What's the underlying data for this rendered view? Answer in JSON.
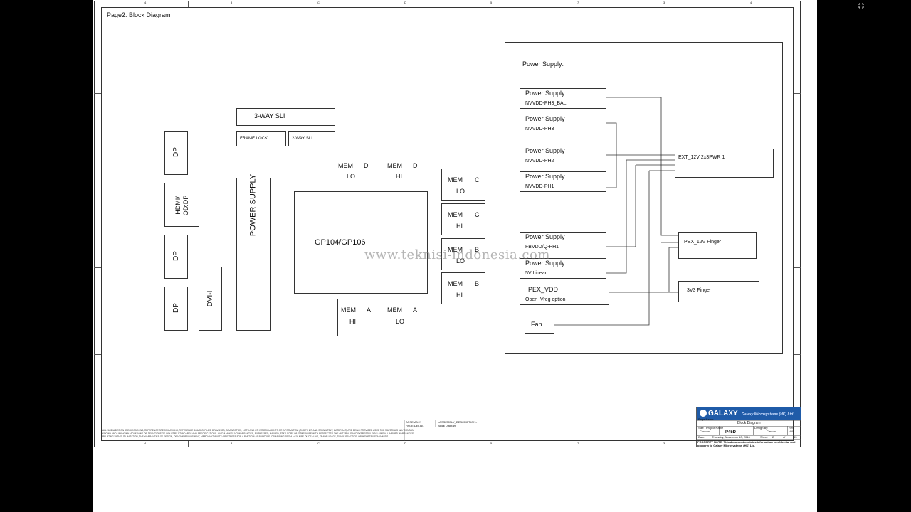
{
  "page_title": "Page2: Block Diagram",
  "sheet": {
    "col_marks_top": [
      "4",
      "3",
      "C",
      "D",
      "5",
      "7",
      "3",
      "4"
    ],
    "col_marks_bottom": [
      "4",
      "3",
      "C",
      "D",
      "5",
      "7",
      "3",
      "4"
    ]
  },
  "left_blocks": {
    "dp1": "DP",
    "hdmi": "HDMI/ QD:DP",
    "dp2": "DP",
    "dp3": "DP",
    "dvi": "DVI-I",
    "power_supply": "POWER SUPPLY"
  },
  "sli": {
    "three_way": "3-WAY SLI",
    "frame_lock": "FRAME LOCK",
    "two_way": "2-WAY SLI"
  },
  "gpu": "GP104/GP106",
  "memory": {
    "d_lo": {
      "name": "MEM",
      "ch": "D",
      "pos": "LO"
    },
    "d_hi": {
      "name": "MEM",
      "ch": "D",
      "pos": "HI"
    },
    "c_lo": {
      "name": "MEM",
      "ch": "C",
      "pos": "LO"
    },
    "c_hi": {
      "name": "MEM",
      "ch": "C",
      "pos": "HI"
    },
    "b_lo": {
      "name": "MEM",
      "ch": "B",
      "pos": "LO"
    },
    "b_hi": {
      "name": "MEM",
      "ch": "B",
      "pos": "HI"
    },
    "a_hi": {
      "name": "MEM",
      "ch": "A",
      "pos": "HI"
    },
    "a_lo": {
      "name": "MEM",
      "ch": "A",
      "pos": "LO"
    }
  },
  "power_panel": {
    "title": "Power Supply:",
    "supplies": [
      {
        "label": "Power Supply",
        "rail": "NVVDD-PH3_BAL"
      },
      {
        "label": "Power Supply",
        "rail": "NVVDD-PH3"
      },
      {
        "label": "Power Supply",
        "rail": "NVVDD-PH2"
      },
      {
        "label": "Power Supply",
        "rail": "NVVDD-PH1"
      },
      {
        "label": "Power Supply",
        "rail": "FBVDD/Q-PH1"
      },
      {
        "label": "Power Supply",
        "rail": "5V Linear"
      }
    ],
    "pex_vdd": {
      "label": "PEX_VDD",
      "sub": "Open_Vreg option"
    },
    "fan": "Fan",
    "ext": "EXT_12V 2x3PWR 1",
    "pex12": "PEX_12V Finger",
    "v3v3": "3V3 Finger"
  },
  "watermark": "www.teknisi-indonesia.com",
  "title_block": {
    "brand": "GALAXY",
    "company": "Galaxy Microsystems (HK) Ltd.",
    "page_name_label": "Page Name:",
    "page_name": "Block Diagram",
    "size_label": "Size",
    "project_label": "Project Name",
    "design_label": "Design By:",
    "rev_label": "Rev",
    "size": "Custom",
    "project": "P45D",
    "designer": "Carson",
    "rev": "V00",
    "date_label": "Date:",
    "date": "Thursday, November 10, 2016",
    "sheet_label": "Sheet",
    "sheet_no": "2",
    "of_label": "of",
    "sheet_total": "33",
    "property_note": "PROPERTY NOTE: This document contains information confidential and property to Galaxy Microsystems (HK) Ltd.",
    "assembly_label": "ASSEMBLY",
    "assembly_value": "<ASSEMBLY_DESCRIPTION>",
    "page_detail_label": "PAGE DETAIL",
    "page_detail_value": "Block Diagram",
    "disclaimer": "ALL NVIDIA DESIGN SPECIFICATIONS, REFERENCE SPECIFICATIONS, REFERENCE BOARDS, FILES, DRAWINGS, DIAGNOSTICS, LISTS AND OTHER DOCUMENTS OR INFORMATION (TOGETHER AND SEPARATELY, MATERIALS) ARE BEING PROVIDED AS IS. THE MATERIALS MAY CONTAIN KNOWN AND UNKNOWN VIOLATIONS OR DEVIATIONS OF INDUSTRY STANDARDS AND SPECIFICATIONS. NVIDIA MAKES NO WARRANTIES, EXPRESSED, IMPLIED, STATUTORY OR OTHERWISE WITH RESPECT TO THE MATERIALS AND EXPRESSLY DISCLAIMS ALL IMPLIED WARRANTIES RELATING WITHOUT LIMITATION, THE WARRANTIES OF DESIGN, OF NONINFRINGEMENT, MERCHANTABILITY OR FITNESS FOR A PARTICULAR PURPOSE, OR ARISING FROM A COURSE OF DEALING, TRADE USAGE, TRADE PRACTICE, OR INDUSTRY STANDARDS."
  }
}
